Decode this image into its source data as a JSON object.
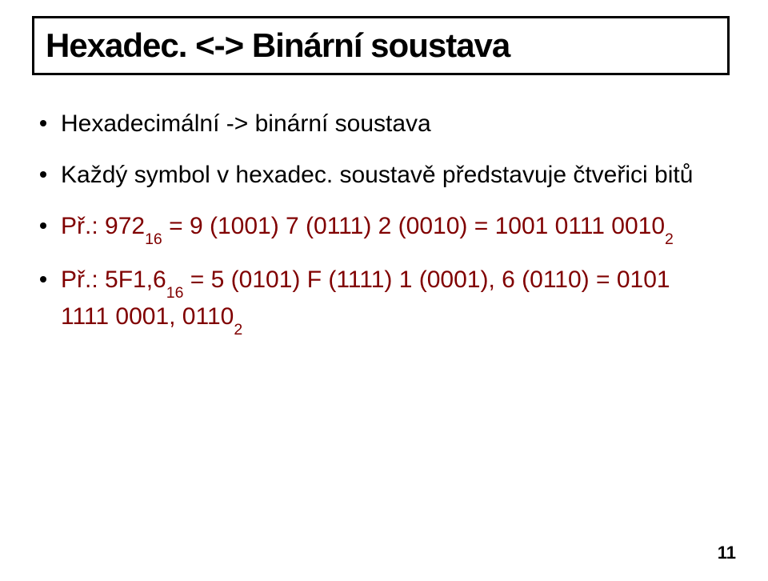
{
  "title": "Hexadec. <-> Binární soustava",
  "bullets": {
    "b1": "Hexadecimální -> binární soustava",
    "b2": "Každý symbol v hexadec. soustavě představuje čtveřici bitů",
    "b3_label": "Př.:",
    "b3_rest_a": " 972",
    "b3_sub_a": "16",
    "b3_rest_b": " = 9 (1001)  7 (0111)  2 (0010) = 1001 0111 0010",
    "b3_sub_b": "2",
    "b4_label": "Př.:",
    "b4_rest_a": " 5F1,6",
    "b4_sub_a": "16",
    "b4_rest_b": " = 5 (0101) F (1111) 1 (0001), 6 (0110) = 0101 1111 0001, 0110",
    "b4_sub_b": "2"
  },
  "page_number": "11"
}
